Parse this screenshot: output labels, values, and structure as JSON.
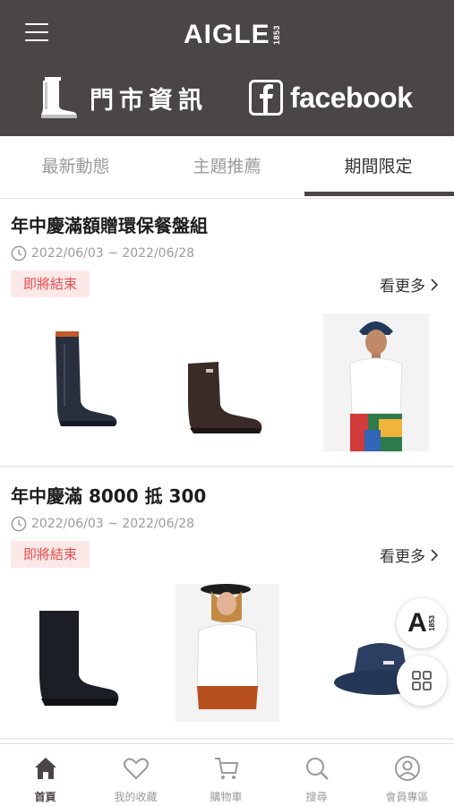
{
  "header": {
    "brand": "AIGLE",
    "brand_year": "1853",
    "store_label": "門市資訊",
    "facebook_label": "facebook",
    "colors": {
      "header_bg": "#4a4645",
      "header_text": "#ffffff"
    }
  },
  "tabs": [
    {
      "label": "最新動態",
      "active": false
    },
    {
      "label": "主題推薦",
      "active": false
    },
    {
      "label": "期間限定",
      "active": true
    }
  ],
  "promotions": [
    {
      "title": "年中慶滿額贈環保餐盤組",
      "date_range": "2022/06/03 ~ 2022/06/28",
      "badge": "即將結束",
      "more_label": "看更多",
      "products": [
        "tall-rain-boot-icon",
        "short-rain-boot-icon",
        "white-tee-model-photo"
      ]
    },
    {
      "title": "年中慶滿 8000 抵 300",
      "date_range": "2022/06/03 ~ 2022/06/28",
      "badge": "即將結束",
      "more_label": "看更多",
      "products": [
        "short-black-rain-boot-icon",
        "white-shirt-model-photo",
        "bucket-hat-icon"
      ]
    }
  ],
  "floating": {
    "logo_letter": "A",
    "logo_year": "1853"
  },
  "bottom_nav": [
    {
      "label": "首頁",
      "icon": "home-icon",
      "active": true
    },
    {
      "label": "我的收藏",
      "icon": "heart-icon",
      "active": false
    },
    {
      "label": "購物車",
      "icon": "cart-icon",
      "active": false
    },
    {
      "label": "搜尋",
      "icon": "search-icon",
      "active": false
    },
    {
      "label": "會員專區",
      "icon": "user-icon",
      "active": false
    }
  ],
  "colors": {
    "badge_bg": "#fde8e8",
    "badge_text": "#e64c4c",
    "active_nav": "#4a4645",
    "inactive": "#9a9a9a"
  }
}
